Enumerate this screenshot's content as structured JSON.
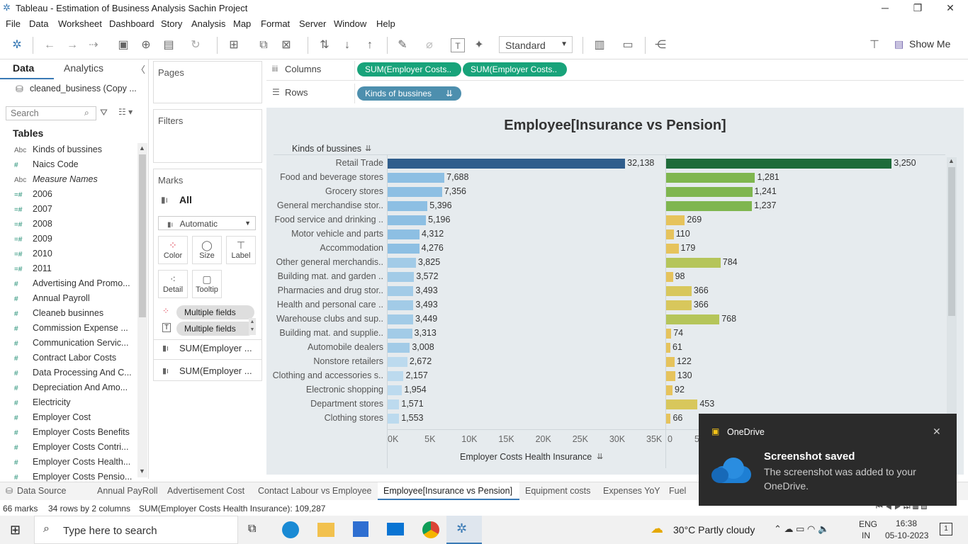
{
  "window": {
    "title": "Tableau - Estimation of Business Analysis Sachin Project"
  },
  "menu": [
    "File",
    "Data",
    "Worksheet",
    "Dashboard",
    "Story",
    "Analysis",
    "Map",
    "Format",
    "Server",
    "Window",
    "Help"
  ],
  "toolbar": {
    "fit": "Standard",
    "show_me": "Show Me"
  },
  "datapane": {
    "tab_data": "Data",
    "tab_analytics": "Analytics",
    "datasource": "cleaned_business (Copy ...",
    "search_placeholder": "Search",
    "tables_label": "Tables",
    "fields": [
      {
        "type": "Abc",
        "name": "Kinds of bussines"
      },
      {
        "type": "#",
        "name": "Naics Code"
      },
      {
        "type": "Abc",
        "name": "Measure Names"
      },
      {
        "type": "=#",
        "name": "2006"
      },
      {
        "type": "=#",
        "name": "2007"
      },
      {
        "type": "=#",
        "name": "2008"
      },
      {
        "type": "=#",
        "name": "2009"
      },
      {
        "type": "=#",
        "name": "2010"
      },
      {
        "type": "=#",
        "name": "2011"
      },
      {
        "type": "#",
        "name": "Advertising And Promo..."
      },
      {
        "type": "#",
        "name": "Annual Payroll"
      },
      {
        "type": "#",
        "name": "Cleaneb businnes"
      },
      {
        "type": "#",
        "name": "Commission Expense ..."
      },
      {
        "type": "#",
        "name": "Communication Servic..."
      },
      {
        "type": "#",
        "name": "Contract Labor Costs"
      },
      {
        "type": "#",
        "name": "Data Processing And C..."
      },
      {
        "type": "#",
        "name": "Depreciation And Amo..."
      },
      {
        "type": "#",
        "name": "Electricity"
      },
      {
        "type": "#",
        "name": "Employer Cost"
      },
      {
        "type": "#",
        "name": "Employer Costs Benefits"
      },
      {
        "type": "#",
        "name": "Employer Costs Contri..."
      },
      {
        "type": "#",
        "name": "Employer Costs Health..."
      },
      {
        "type": "#",
        "name": "Employer Costs Pensio..."
      }
    ]
  },
  "shelves": {
    "pages": "Pages",
    "filters": "Filters",
    "marks": "Marks",
    "marks_all": "All",
    "marks_type": "Automatic",
    "buttons": [
      "Color",
      "Size",
      "Label",
      "Detail",
      "Tooltip"
    ],
    "multiple_fields_1": "Multiple fields",
    "multiple_fields_2": "Multiple fields",
    "sum_1": "SUM(Employer ...",
    "sum_2": "SUM(Employer ...",
    "columns_label": "Columns",
    "rows_label": "Rows",
    "col_pill_1": "SUM(Employer Costs..",
    "col_pill_2": "SUM(Employer Costs..",
    "row_pill": "Kinds of bussines"
  },
  "chart_data": {
    "type": "bar",
    "title": "Employee[Insurance vs Pension]",
    "row_header": "Kinds of bussines",
    "xlabel_left": "Employer Costs Health Insurance",
    "ticks_left": [
      "0K",
      "5K",
      "10K",
      "15K",
      "20K",
      "25K",
      "30K",
      "35K"
    ],
    "ticks_right": [
      "0",
      "5"
    ],
    "xlim_left": [
      0,
      35000
    ],
    "xlim_right": [
      0,
      3400
    ],
    "categories": [
      "Retail Trade",
      "Food and beverage stores",
      "Grocery stores",
      "General merchandise stor..",
      "Food service and drinking ..",
      "Motor vehicle and parts",
      "Accommodation",
      "Other general merchandis..",
      "Building mat. and garden ..",
      "Pharmacies and drug stor..",
      "Health and personal care ..",
      "Warehouse clubs and sup..",
      "Building mat. and supplie..",
      "Automobile dealers",
      "Nonstore retailers",
      "Clothing and accessories s..",
      "Electronic shopping",
      "Department stores",
      "Clothing stores"
    ],
    "series": [
      {
        "values": [
          32138,
          7688,
          7356,
          5396,
          5196,
          4312,
          4276,
          3825,
          3572,
          3493,
          3493,
          3449,
          3313,
          3008,
          2672,
          2157,
          1954,
          1571,
          1553
        ],
        "labels": [
          "32,138",
          "7,688",
          "7,356",
          "5,396",
          "5,196",
          "4,312",
          "4,276",
          "3,825",
          "3,572",
          "3,493",
          "3,493",
          "3,449",
          "3,313",
          "3,008",
          "2,672",
          "2,157",
          "1,954",
          "1,571",
          "1,553"
        ]
      },
      {
        "values": [
          3250,
          1281,
          1241,
          1237,
          269,
          110,
          179,
          784,
          98,
          366,
          366,
          768,
          74,
          61,
          122,
          130,
          92,
          453,
          66
        ],
        "labels": [
          "3,250",
          "1,281",
          "1,241",
          "1,237",
          "269",
          "110",
          "179",
          "784",
          "98",
          "366",
          "366",
          "768",
          "74",
          "61",
          "122",
          "130",
          "92",
          "453",
          "66"
        ]
      }
    ]
  },
  "colors": {
    "left_top": "#2f5d8c",
    "left_scale": [
      "#a9cfe8",
      "#7fb6de"
    ],
    "right_top": "#1e6b3a",
    "right_mid": "#7fb64f",
    "right_low": "#e6c35c"
  },
  "sheet_tabs": [
    "Data Source",
    "Annual PayRoll",
    "Advertisement Cost",
    "Contact Labour vs Employee",
    "Employee[Insurance vs Pension]",
    "Equipment costs",
    "Expenses YoY",
    "Fuel"
  ],
  "status": {
    "marks": "66 marks",
    "rows": "34 rows by 2 columns",
    "sum": "SUM(Employer Costs Health Insurance): 109,287"
  },
  "taskbar": {
    "search": "Type here to search",
    "weather": "30°C  Partly cloudy",
    "lang1": "ENG",
    "lang2": "IN",
    "time": "16:38",
    "date": "05-10-2023",
    "notif": "1"
  },
  "onedrive": {
    "app": "OneDrive",
    "title": "Screenshot saved",
    "body": "The screenshot was added to your OneDrive."
  }
}
